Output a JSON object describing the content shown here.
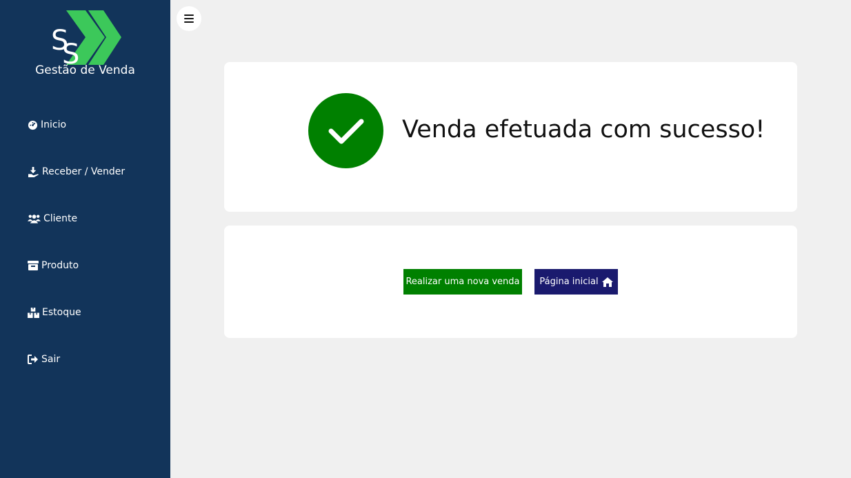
{
  "app": {
    "logo_initials": "SS",
    "logo_text": "Gestão de Venda"
  },
  "sidebar": {
    "items": [
      {
        "label": "Inicio",
        "icon": "dashboard-icon"
      },
      {
        "label": "Receber / Vender",
        "icon": "hand-receive-icon"
      },
      {
        "label": "Cliente",
        "icon": "users-icon"
      },
      {
        "label": "Produto",
        "icon": "box-icon"
      },
      {
        "label": "Estoque",
        "icon": "boxes-icon"
      },
      {
        "label": "Sair",
        "icon": "sign-out-icon"
      }
    ]
  },
  "toolbar": {
    "menu_icon": "hamburger-icon"
  },
  "main": {
    "success_message": "Venda efetuada com sucesso!",
    "new_sale_label": "Realizar uma nova venda",
    "home_label": "Página inicial"
  },
  "colors": {
    "sidebar_bg": "#12345a",
    "success_green": "#008000",
    "home_button": "#1a1a6e",
    "logo_green": "#3cc85a"
  }
}
